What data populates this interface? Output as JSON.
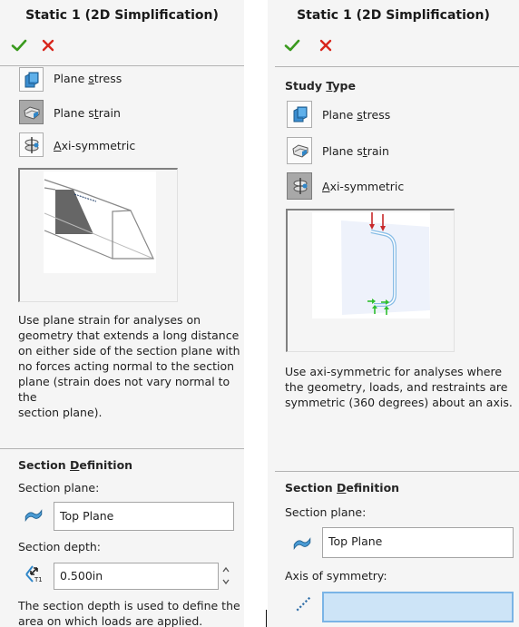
{
  "left_panel": {
    "title": "Static 1 (2D Simplification)",
    "ok_icon": "checkmark-icon",
    "cancel_icon": "close-icon",
    "study_type_options": [
      {
        "pre": "Plane ",
        "u": "s",
        "post": "tress",
        "icon": "plane-stress-icon",
        "selected": false
      },
      {
        "pre": "Plane s",
        "u": "t",
        "post": "rain",
        "icon": "plane-strain-icon",
        "selected": true
      },
      {
        "pre": "",
        "u": "A",
        "post": "xi-symmetric",
        "icon": "axi-symmetric-icon",
        "selected": false
      }
    ],
    "preview_image": "plane-strain-illustration",
    "description_lines": [
      "Use plane strain for analyses on",
      "geometry that extends a long distance",
      "on either side of the section plane with",
      "no forces acting normal to the section",
      "plane (strain does not vary normal to the",
      "section plane)."
    ],
    "section_definition": {
      "title_pre": "Section ",
      "title_u": "D",
      "title_post": "efinition",
      "section_plane_label": "Section plane:",
      "section_plane_value": "Top Plane",
      "section_depth_label": "Section depth:",
      "section_depth_value": "0.500in",
      "note_lines": [
        "The section depth is used to define the",
        "area on which loads are applied."
      ]
    }
  },
  "right_panel": {
    "title": "Static 1 (2D Simplification)",
    "ok_icon": "checkmark-icon",
    "cancel_icon": "close-icon",
    "study_type_title_pre": "Study ",
    "study_type_title_u": "T",
    "study_type_title_post": "ype",
    "study_type_options": [
      {
        "pre": "Plane ",
        "u": "s",
        "post": "tress",
        "icon": "plane-stress-icon",
        "selected": false
      },
      {
        "pre": "Plane s",
        "u": "t",
        "post": "rain",
        "icon": "plane-strain-icon",
        "selected": false
      },
      {
        "pre": "",
        "u": "A",
        "post": "xi-symmetric",
        "icon": "axi-symmetric-icon",
        "selected": true
      }
    ],
    "preview_image": "axi-symmetric-illustration",
    "description_lines": [
      "Use axi-symmetric for analyses where",
      "the geometry, loads, and restraints are",
      "symmetric (360 degrees) about an axis."
    ],
    "section_definition": {
      "title_pre": "Section ",
      "title_u": "D",
      "title_post": "efinition",
      "section_plane_label": "Section plane:",
      "section_plane_value": "Top Plane",
      "axis_label": "Axis of symmetry:",
      "axis_value": ""
    }
  },
  "colors": {
    "ok": "#3a9a1e",
    "cancel": "#d8261c",
    "icon_blue": "#2f86c8",
    "active_field": "#cde4f7",
    "load_arrow": "#c8282a",
    "restraint_arrow": "#2fbf2f"
  }
}
